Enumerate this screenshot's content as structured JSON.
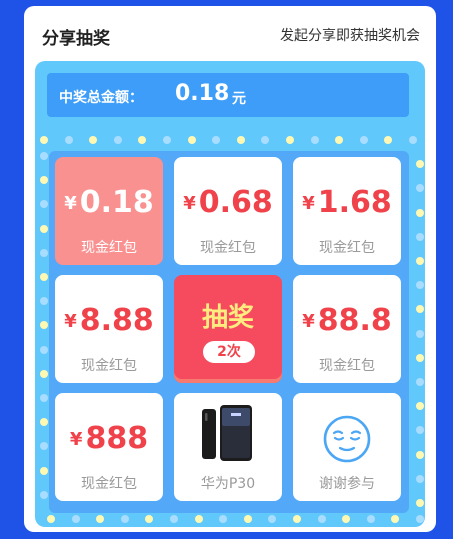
{
  "header": {
    "title": "分享抽奖",
    "share_link": "发起分享即获抽奖机会"
  },
  "total": {
    "label": "中奖总金额：",
    "amount": "0.18",
    "unit": "元"
  },
  "prizes": [
    {
      "value": "0.18",
      "label": "现金红包"
    },
    {
      "value": "0.68",
      "label": "现金红包"
    },
    {
      "value": "1.68",
      "label": "现金红包"
    },
    {
      "value": "8.88",
      "label": "现金红包"
    },
    {
      "value": "88.8",
      "label": "现金红包"
    },
    {
      "value": "888",
      "label": "现金红包"
    },
    {
      "value": "",
      "label": "华为P30",
      "icon": "phone-icon"
    },
    {
      "value": "",
      "label": "谢谢参与",
      "icon": "smiley-face-icon"
    }
  ],
  "draw": {
    "label": "抽奖",
    "count": "2次"
  },
  "currency_symbol": "¥",
  "colors": {
    "background": "#1f52e6",
    "board": "#61c8fb",
    "total_bar": "#3d9df8",
    "prize_text": "#f0424a",
    "active_cell": "#f99190",
    "draw_button": "#f64a5e",
    "draw_label": "#ffec80"
  }
}
